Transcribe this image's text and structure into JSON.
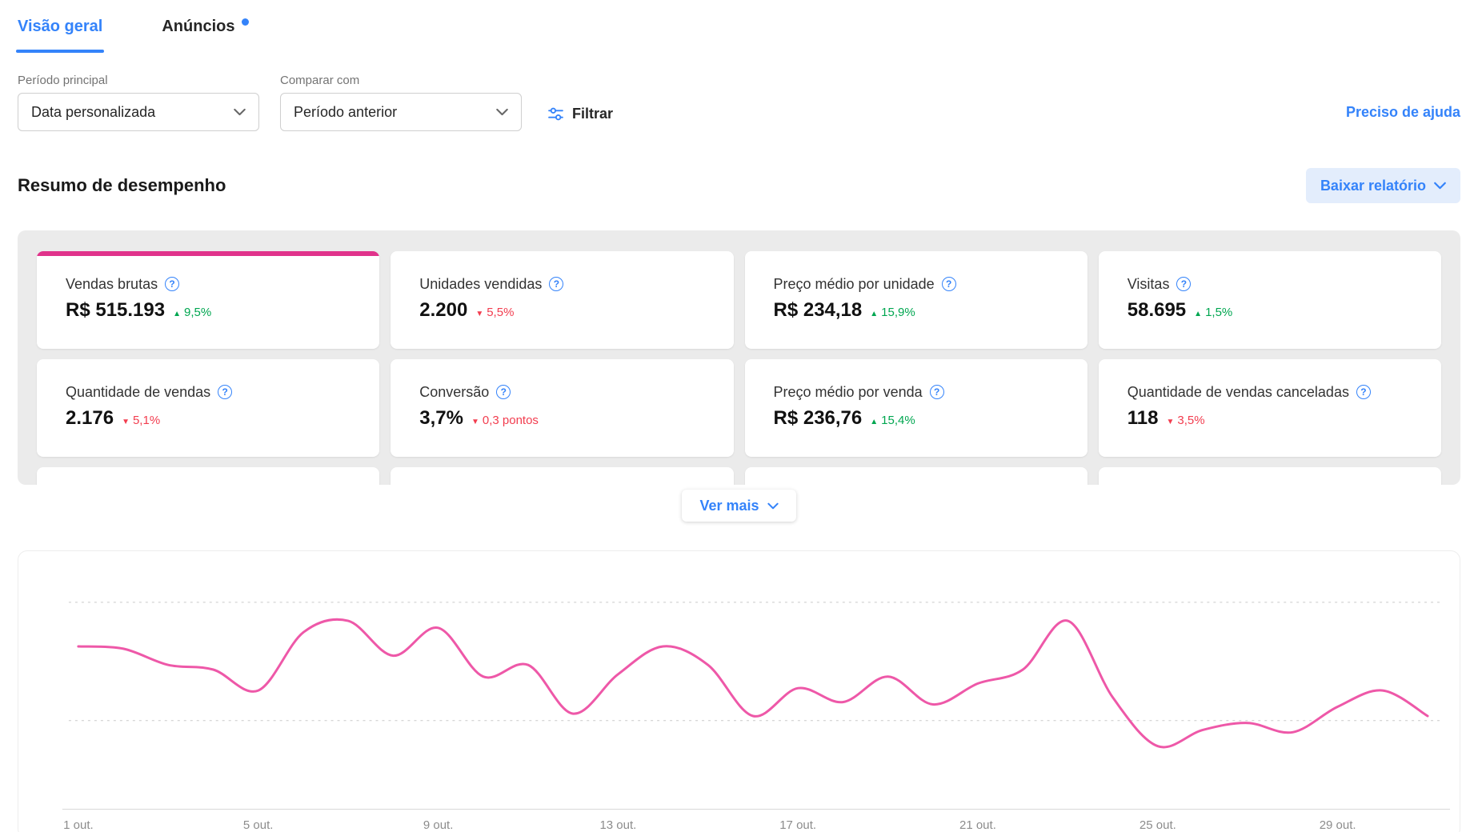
{
  "tabs": {
    "overview": "Visão geral",
    "ads": "Anúncios"
  },
  "filters": {
    "main_period_label": "Período principal",
    "main_period_value": "Data personalizada",
    "compare_label": "Comparar com",
    "compare_value": "Período anterior",
    "filter_button_label": "Filtrar",
    "help_link_label": "Preciso de ajuda"
  },
  "summary": {
    "title": "Resumo de desempenho",
    "download_button_label": "Baixar relatório",
    "see_more_label": "Ver mais"
  },
  "metrics": {
    "cards": [
      {
        "label": "Vendas brutas",
        "value": "R$ 515.193",
        "delta": "9,5%",
        "trend": "up",
        "selected": true
      },
      {
        "label": "Unidades vendidas",
        "value": "2.200",
        "delta": "5,5%",
        "trend": "down",
        "selected": false
      },
      {
        "label": "Preço médio por unidade",
        "value": "R$ 234,18",
        "delta": "15,9%",
        "trend": "up",
        "selected": false
      },
      {
        "label": "Visitas",
        "value": "58.695",
        "delta": "1,5%",
        "trend": "up",
        "selected": false
      },
      {
        "label": "Quantidade de vendas",
        "value": "2.176",
        "delta": "5,1%",
        "trend": "down",
        "selected": false
      },
      {
        "label": "Conversão",
        "value": "3,7%",
        "delta": "0,3 pontos",
        "trend": "down",
        "selected": false
      },
      {
        "label": "Preço médio por venda",
        "value": "R$ 236,76",
        "delta": "15,4%",
        "trend": "up",
        "selected": false
      },
      {
        "label": "Quantidade de vendas canceladas",
        "value": "118",
        "delta": "3,5%",
        "trend": "down",
        "selected": false
      }
    ]
  },
  "icons": {
    "help": "?",
    "chevron_down": "chevron-down",
    "filter_sliders": "tune-sliders"
  },
  "colors": {
    "accent_blue": "#3483fa",
    "positive_green": "#00a650",
    "negative_red": "#f23d4f",
    "selected_card_pink": "#e0338b",
    "chart_line_pink": "#ee58a8",
    "panel_gray": "#ebebeb"
  },
  "chart_data": {
    "type": "line",
    "title": "",
    "xlabel": "",
    "ylabel": "",
    "x_unit": "day of October",
    "x": [
      1,
      2,
      3,
      4,
      5,
      6,
      7,
      8,
      9,
      10,
      11,
      12,
      13,
      14,
      15,
      16,
      17,
      18,
      19,
      20,
      21,
      22,
      23,
      24,
      25,
      26,
      27,
      28,
      29,
      30,
      31
    ],
    "series": [
      {
        "name": "Vendas brutas - período principal",
        "values": [
          70,
          69,
          62,
          60,
          51,
          76,
          81,
          66,
          78,
          57,
          62,
          41,
          58,
          70,
          62,
          40,
          52,
          46,
          57,
          45,
          54,
          60,
          81,
          48,
          27,
          34,
          37,
          33,
          44,
          51,
          40
        ]
      }
    ],
    "y_scale": "relative 0-100 (no visible y-axis labels)",
    "gridline_values": [
      89,
      38
    ],
    "tick_days": [
      1,
      5,
      9,
      13,
      17,
      21,
      25,
      29
    ],
    "tick_labels": [
      "1 out.",
      "5 out.",
      "9 out.",
      "13 out.",
      "17 out.",
      "21 out.",
      "25 out.",
      "29 out."
    ],
    "line_color": "#ee58a8",
    "grid": "horizontal-dashed",
    "legend": "none"
  }
}
